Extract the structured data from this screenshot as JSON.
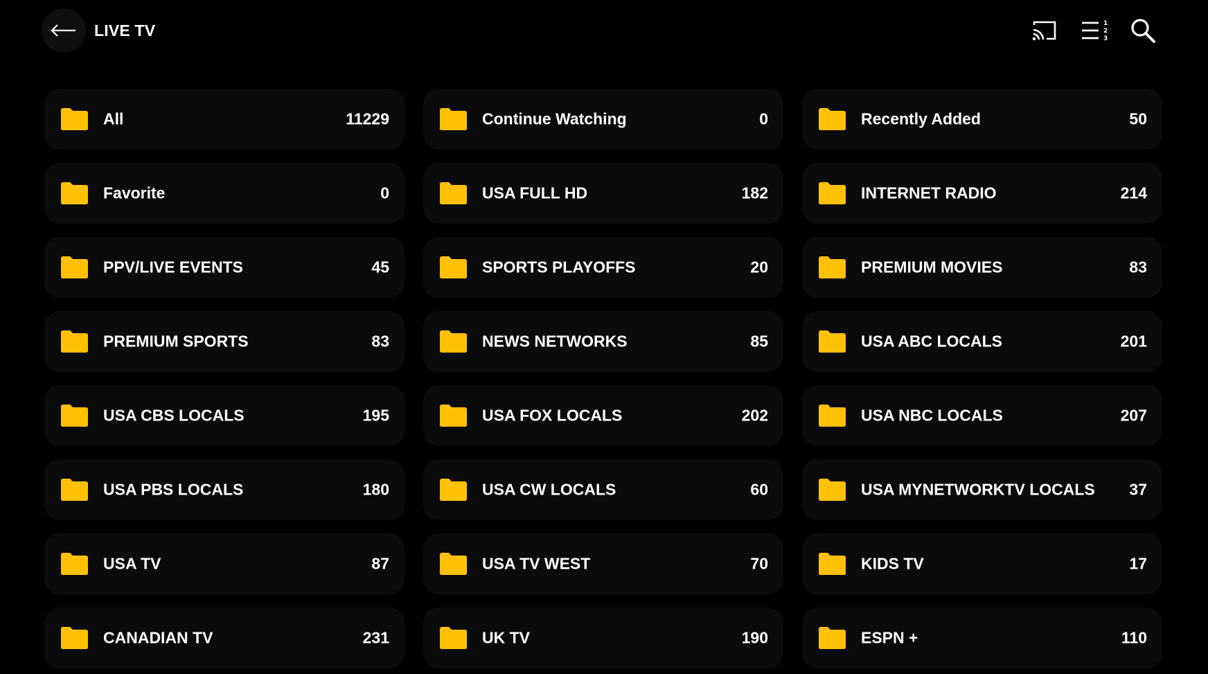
{
  "header": {
    "title": "LIVE TV",
    "back_icon": "arrow-left-icon",
    "right_icons": [
      "cast-icon",
      "sort-list-icon",
      "search-icon"
    ]
  },
  "colors": {
    "background": "#000000",
    "tile": "#0b0b0b",
    "folder": "#FFC107",
    "text": "#FFFFFF"
  },
  "categories": [
    {
      "label": "All",
      "count": "11229"
    },
    {
      "label": "Continue Watching",
      "count": "0"
    },
    {
      "label": "Recently Added",
      "count": "50"
    },
    {
      "label": "Favorite",
      "count": "0"
    },
    {
      "label": "USA FULL HD",
      "count": "182"
    },
    {
      "label": "INTERNET RADIO",
      "count": "214"
    },
    {
      "label": "PPV/LIVE EVENTS",
      "count": "45"
    },
    {
      "label": "SPORTS PLAYOFFS",
      "count": "20"
    },
    {
      "label": "PREMIUM MOVIES",
      "count": "83"
    },
    {
      "label": "PREMIUM SPORTS",
      "count": "83"
    },
    {
      "label": "NEWS NETWORKS",
      "count": "85"
    },
    {
      "label": "USA ABC LOCALS",
      "count": "201"
    },
    {
      "label": "USA CBS LOCALS",
      "count": "195"
    },
    {
      "label": "USA FOX LOCALS",
      "count": "202"
    },
    {
      "label": "USA NBC LOCALS",
      "count": "207"
    },
    {
      "label": "USA PBS LOCALS",
      "count": "180"
    },
    {
      "label": "USA CW LOCALS",
      "count": "60"
    },
    {
      "label": "USA MYNETWORKTV LOCALS",
      "count": "37"
    },
    {
      "label": "USA TV",
      "count": "87"
    },
    {
      "label": "USA TV WEST",
      "count": "70"
    },
    {
      "label": "KIDS TV",
      "count": "17"
    },
    {
      "label": "CANADIAN TV",
      "count": "231"
    },
    {
      "label": "UK TV",
      "count": "190"
    },
    {
      "label": "ESPN +",
      "count": "110"
    }
  ]
}
